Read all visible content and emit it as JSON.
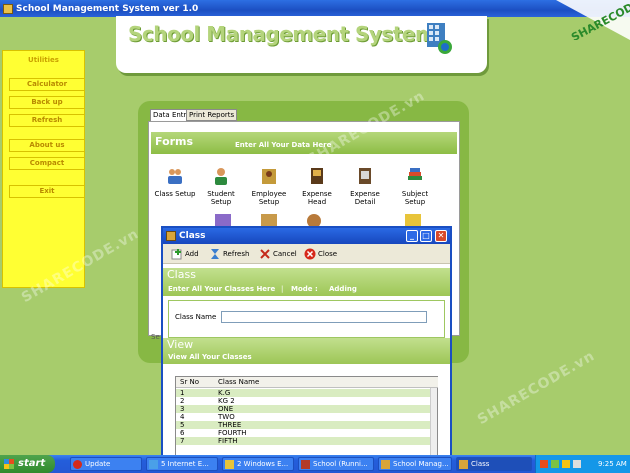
{
  "window": {
    "title": "School Management System ver 1.0"
  },
  "banner": {
    "title": "School Management System"
  },
  "utilities": {
    "title": "Utilities",
    "buttons": [
      "Calculator",
      "Back up",
      "Refresh",
      "About us",
      "Compact",
      "Exit"
    ]
  },
  "forms": {
    "tabs": [
      "Data Entry",
      "Print Reports"
    ],
    "heading": "Forms",
    "subheading": "Enter All Your Data Here",
    "icons": [
      "Class Setup",
      "Student Setup",
      "Employee Setup",
      "Expense Head",
      "Expense Detail",
      "Subject Setup"
    ],
    "partial_label": "Se"
  },
  "dialog": {
    "title": "Class",
    "toolbar": {
      "add": "Add",
      "refresh": "Refresh",
      "cancel": "Cancel",
      "close": "Close"
    },
    "section1": {
      "title": "Class",
      "subtitle": "Enter All Your Classes Here",
      "mode_label": "Mode :",
      "mode_value": "Adding"
    },
    "class_name_label": "Class Name",
    "class_name_value": "",
    "section2": {
      "title": "View",
      "subtitle": "View All Your Classes"
    },
    "grid": {
      "columns": [
        "Sr No",
        "Class Name"
      ],
      "rows": [
        [
          "1",
          "K.G"
        ],
        [
          "2",
          "KG 2"
        ],
        [
          "3",
          "ONE"
        ],
        [
          "4",
          "TWO"
        ],
        [
          "5",
          "THREE"
        ],
        [
          "6",
          "FOURTH"
        ],
        [
          "7",
          "FIFTH"
        ]
      ]
    }
  },
  "taskbar": {
    "start": "start",
    "tasks": [
      "Update",
      "5 Internet E...",
      "2 Windows E...",
      "School (Runni...",
      "School Manag...",
      "Class"
    ],
    "clock": "9:25 AM"
  },
  "watermark": "SHARECODE.vn",
  "colors": {
    "background": "#a7cc6c",
    "accent_green": "#87b844",
    "titlebar_blue": "#1c4fc2",
    "utility_yellow": "#ffff33"
  }
}
